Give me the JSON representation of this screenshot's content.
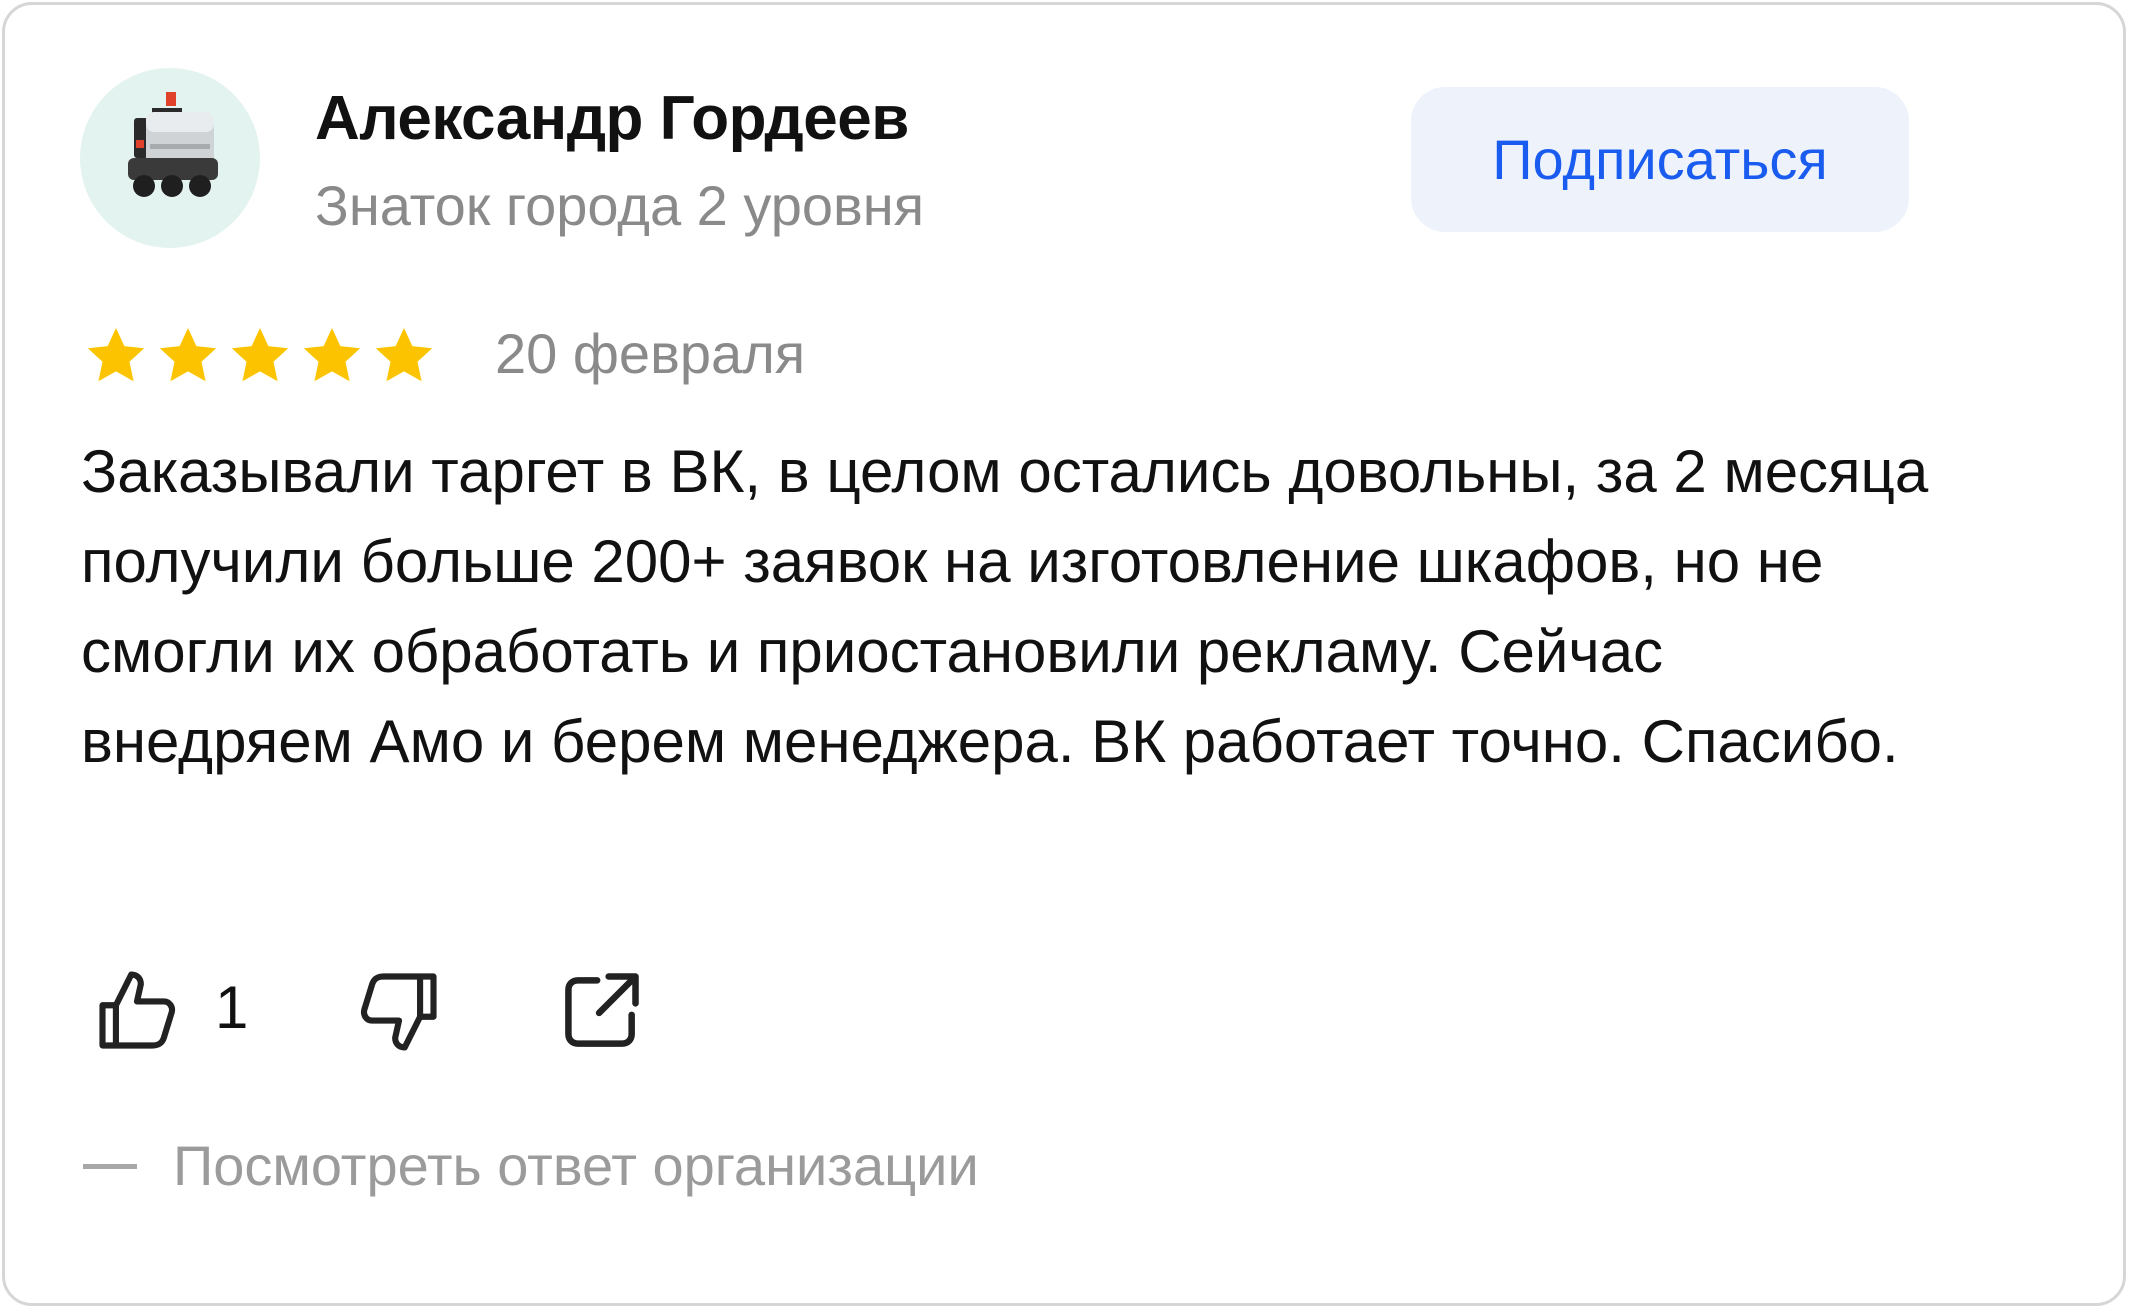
{
  "review": {
    "author": {
      "name": "Александр Гордеев",
      "level": "Знаток города 2 уровня"
    },
    "subscribe_label": "Подписаться",
    "rating": 5,
    "rating_max": 5,
    "date": "20 февраля",
    "text": "Заказывали таргет в ВК, в целом остались довольны, за 2 месяца получили больше 200+ заявок на изготовление шкафов, но не смогли их обработать и приостановили рекламу. Сейчас внедряем Амо и берем менеджера. ВК работает точно. Спасибо.",
    "actions": {
      "like_icon": "thumbs-up-icon",
      "like_count": "1",
      "dislike_icon": "thumbs-down-icon",
      "share_icon": "share-icon"
    },
    "org_reply_label": "Посмотреть ответ организации"
  },
  "colors": {
    "accent": "#1a5cf0",
    "star": "#fcc400",
    "muted_text": "#8a8a8a",
    "button_bg": "#eef3fb"
  }
}
